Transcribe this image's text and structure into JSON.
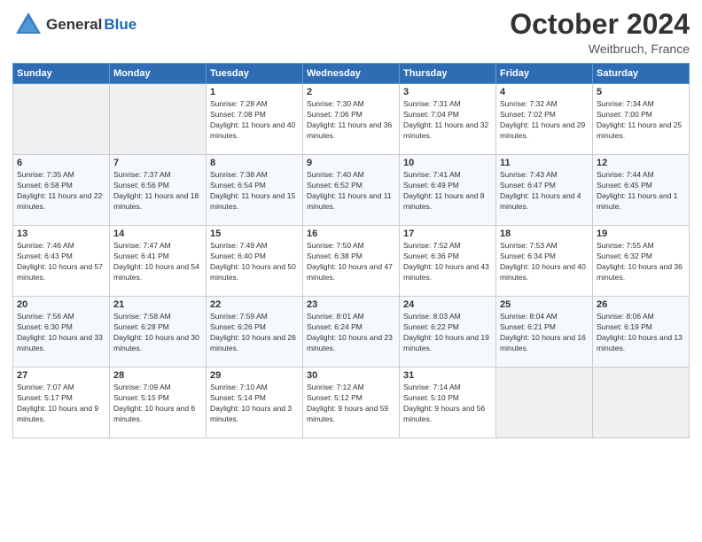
{
  "header": {
    "logo_general": "General",
    "logo_blue": "Blue",
    "month": "October 2024",
    "location": "Weitbruch, France"
  },
  "columns": [
    "Sunday",
    "Monday",
    "Tuesday",
    "Wednesday",
    "Thursday",
    "Friday",
    "Saturday"
  ],
  "weeks": [
    {
      "days": [
        {
          "number": "",
          "sunrise": "",
          "sunset": "",
          "daylight": "",
          "empty": true
        },
        {
          "number": "",
          "sunrise": "",
          "sunset": "",
          "daylight": "",
          "empty": true
        },
        {
          "number": "1",
          "sunrise": "Sunrise: 7:28 AM",
          "sunset": "Sunset: 7:08 PM",
          "daylight": "Daylight: 11 hours and 40 minutes."
        },
        {
          "number": "2",
          "sunrise": "Sunrise: 7:30 AM",
          "sunset": "Sunset: 7:06 PM",
          "daylight": "Daylight: 11 hours and 36 minutes."
        },
        {
          "number": "3",
          "sunrise": "Sunrise: 7:31 AM",
          "sunset": "Sunset: 7:04 PM",
          "daylight": "Daylight: 11 hours and 32 minutes."
        },
        {
          "number": "4",
          "sunrise": "Sunrise: 7:32 AM",
          "sunset": "Sunset: 7:02 PM",
          "daylight": "Daylight: 11 hours and 29 minutes."
        },
        {
          "number": "5",
          "sunrise": "Sunrise: 7:34 AM",
          "sunset": "Sunset: 7:00 PM",
          "daylight": "Daylight: 11 hours and 25 minutes."
        }
      ]
    },
    {
      "days": [
        {
          "number": "6",
          "sunrise": "Sunrise: 7:35 AM",
          "sunset": "Sunset: 6:58 PM",
          "daylight": "Daylight: 11 hours and 22 minutes."
        },
        {
          "number": "7",
          "sunrise": "Sunrise: 7:37 AM",
          "sunset": "Sunset: 6:56 PM",
          "daylight": "Daylight: 11 hours and 18 minutes."
        },
        {
          "number": "8",
          "sunrise": "Sunrise: 7:38 AM",
          "sunset": "Sunset: 6:54 PM",
          "daylight": "Daylight: 11 hours and 15 minutes."
        },
        {
          "number": "9",
          "sunrise": "Sunrise: 7:40 AM",
          "sunset": "Sunset: 6:52 PM",
          "daylight": "Daylight: 11 hours and 11 minutes."
        },
        {
          "number": "10",
          "sunrise": "Sunrise: 7:41 AM",
          "sunset": "Sunset: 6:49 PM",
          "daylight": "Daylight: 11 hours and 8 minutes."
        },
        {
          "number": "11",
          "sunrise": "Sunrise: 7:43 AM",
          "sunset": "Sunset: 6:47 PM",
          "daylight": "Daylight: 11 hours and 4 minutes."
        },
        {
          "number": "12",
          "sunrise": "Sunrise: 7:44 AM",
          "sunset": "Sunset: 6:45 PM",
          "daylight": "Daylight: 11 hours and 1 minute."
        }
      ]
    },
    {
      "days": [
        {
          "number": "13",
          "sunrise": "Sunrise: 7:46 AM",
          "sunset": "Sunset: 6:43 PM",
          "daylight": "Daylight: 10 hours and 57 minutes."
        },
        {
          "number": "14",
          "sunrise": "Sunrise: 7:47 AM",
          "sunset": "Sunset: 6:41 PM",
          "daylight": "Daylight: 10 hours and 54 minutes."
        },
        {
          "number": "15",
          "sunrise": "Sunrise: 7:49 AM",
          "sunset": "Sunset: 6:40 PM",
          "daylight": "Daylight: 10 hours and 50 minutes."
        },
        {
          "number": "16",
          "sunrise": "Sunrise: 7:50 AM",
          "sunset": "Sunset: 6:38 PM",
          "daylight": "Daylight: 10 hours and 47 minutes."
        },
        {
          "number": "17",
          "sunrise": "Sunrise: 7:52 AM",
          "sunset": "Sunset: 6:36 PM",
          "daylight": "Daylight: 10 hours and 43 minutes."
        },
        {
          "number": "18",
          "sunrise": "Sunrise: 7:53 AM",
          "sunset": "Sunset: 6:34 PM",
          "daylight": "Daylight: 10 hours and 40 minutes."
        },
        {
          "number": "19",
          "sunrise": "Sunrise: 7:55 AM",
          "sunset": "Sunset: 6:32 PM",
          "daylight": "Daylight: 10 hours and 36 minutes."
        }
      ]
    },
    {
      "days": [
        {
          "number": "20",
          "sunrise": "Sunrise: 7:56 AM",
          "sunset": "Sunset: 6:30 PM",
          "daylight": "Daylight: 10 hours and 33 minutes."
        },
        {
          "number": "21",
          "sunrise": "Sunrise: 7:58 AM",
          "sunset": "Sunset: 6:28 PM",
          "daylight": "Daylight: 10 hours and 30 minutes."
        },
        {
          "number": "22",
          "sunrise": "Sunrise: 7:59 AM",
          "sunset": "Sunset: 6:26 PM",
          "daylight": "Daylight: 10 hours and 26 minutes."
        },
        {
          "number": "23",
          "sunrise": "Sunrise: 8:01 AM",
          "sunset": "Sunset: 6:24 PM",
          "daylight": "Daylight: 10 hours and 23 minutes."
        },
        {
          "number": "24",
          "sunrise": "Sunrise: 8:03 AM",
          "sunset": "Sunset: 6:22 PM",
          "daylight": "Daylight: 10 hours and 19 minutes."
        },
        {
          "number": "25",
          "sunrise": "Sunrise: 8:04 AM",
          "sunset": "Sunset: 6:21 PM",
          "daylight": "Daylight: 10 hours and 16 minutes."
        },
        {
          "number": "26",
          "sunrise": "Sunrise: 8:06 AM",
          "sunset": "Sunset: 6:19 PM",
          "daylight": "Daylight: 10 hours and 13 minutes."
        }
      ]
    },
    {
      "days": [
        {
          "number": "27",
          "sunrise": "Sunrise: 7:07 AM",
          "sunset": "Sunset: 5:17 PM",
          "daylight": "Daylight: 10 hours and 9 minutes."
        },
        {
          "number": "28",
          "sunrise": "Sunrise: 7:09 AM",
          "sunset": "Sunset: 5:15 PM",
          "daylight": "Daylight: 10 hours and 6 minutes."
        },
        {
          "number": "29",
          "sunrise": "Sunrise: 7:10 AM",
          "sunset": "Sunset: 5:14 PM",
          "daylight": "Daylight: 10 hours and 3 minutes."
        },
        {
          "number": "30",
          "sunrise": "Sunrise: 7:12 AM",
          "sunset": "Sunset: 5:12 PM",
          "daylight": "Daylight: 9 hours and 59 minutes."
        },
        {
          "number": "31",
          "sunrise": "Sunrise: 7:14 AM",
          "sunset": "Sunset: 5:10 PM",
          "daylight": "Daylight: 9 hours and 56 minutes."
        },
        {
          "number": "",
          "sunrise": "",
          "sunset": "",
          "daylight": "",
          "empty": true
        },
        {
          "number": "",
          "sunrise": "",
          "sunset": "",
          "daylight": "",
          "empty": true
        }
      ]
    }
  ]
}
